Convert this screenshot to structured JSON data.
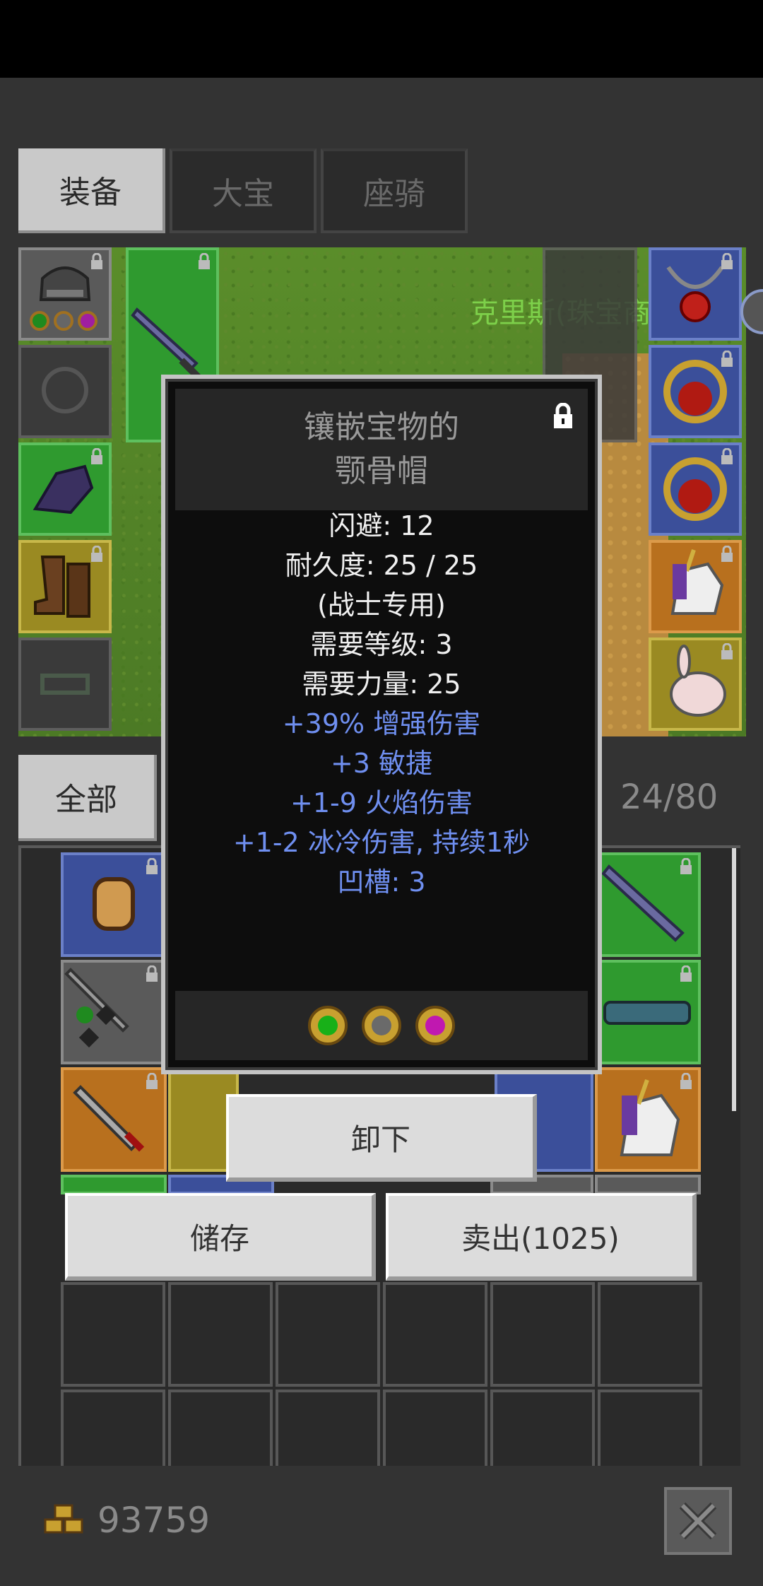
{
  "tabs": [
    {
      "label": "装备",
      "active": true
    },
    {
      "label": "大宝",
      "active": false
    },
    {
      "label": "座骑",
      "active": false
    }
  ],
  "scene": {
    "npc_name": "克里斯(珠宝商)"
  },
  "bag": {
    "filter_tab": "全部",
    "capacity": "24/80"
  },
  "tooltip": {
    "name_line1": "镶嵌宝物的",
    "name_line2": "颚骨帽",
    "stats": [
      {
        "text": "闪避: 12",
        "color": "#f0f0f0"
      },
      {
        "text": "耐久度: 25 / 25",
        "color": "#f0f0f0"
      },
      {
        "text": "(战士专用)",
        "color": "#f0f0f0"
      },
      {
        "text": "需要等级: 3",
        "color": "#f0f0f0"
      },
      {
        "text": "需要力量: 25",
        "color": "#f0f0f0"
      },
      {
        "text": "+39% 增强伤害",
        "color": "#6f8ff0"
      },
      {
        "text": "+3 敏捷",
        "color": "#6f8ff0"
      },
      {
        "text": "+1-9 火焰伤害",
        "color": "#6f8ff0"
      },
      {
        "text": "+1-2 冰冷伤害, 持续1秒",
        "color": "#6f8ff0"
      },
      {
        "text": "凹槽: 3",
        "color": "#6f8ff0"
      }
    ],
    "gems": [
      "emerald-gem-icon",
      "skull-gem-icon",
      "amethyst-gem-icon"
    ]
  },
  "actions": {
    "unequip_label": "卸下",
    "store_label": "储存",
    "sell_label": "卖出(1025)"
  },
  "footer": {
    "gold": "93759"
  }
}
